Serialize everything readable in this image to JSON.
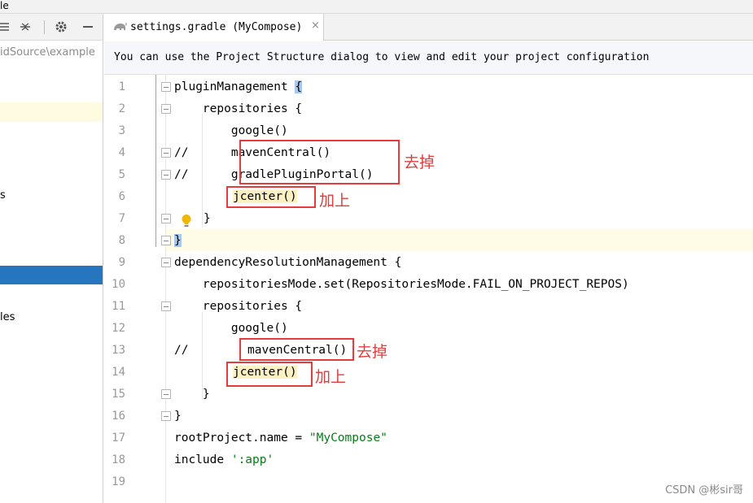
{
  "window": {
    "menu_fragment": "le"
  },
  "project_panel": {
    "toolbar": {
      "collapse_icon": "collapse-all-icon",
      "expand_icon": "expand-all-icon",
      "settings_icon": "gear-icon",
      "hide_icon": "minimize-icon"
    },
    "path_fragment": "idSource\\example",
    "items": [
      {
        "label": "s"
      },
      {
        "label": "les"
      }
    ]
  },
  "editor": {
    "tab": {
      "label": "settings.gradle (MyCompose)",
      "close": "×"
    },
    "banner": "You can use the Project Structure dialog to view and edit your project configuration",
    "line_numbers": [
      "1",
      "2",
      "3",
      "4",
      "5",
      "6",
      "7",
      "8",
      "9",
      "10",
      "11",
      "12",
      "13",
      "14",
      "15",
      "16",
      "17",
      "18",
      "19"
    ],
    "lines": [
      {
        "prefix": "",
        "text": "pluginManagement "
      },
      {
        "prefix": "",
        "text": "    repositories {"
      },
      {
        "prefix": "",
        "text": "        google()"
      },
      {
        "prefix": "//",
        "text": "      mavenCentral()"
      },
      {
        "prefix": "//",
        "text": "      gradlePluginPortal()"
      },
      {
        "prefix": "",
        "text": "jcenter()"
      },
      {
        "prefix": "",
        "text": "}"
      },
      {
        "prefix": "",
        "text": "}"
      },
      {
        "prefix": "",
        "text": "dependencyResolutionManagement {"
      },
      {
        "prefix": "",
        "text": "    repositoriesMode.set(RepositoriesMode.FAIL_ON_PROJECT_REPOS)"
      },
      {
        "prefix": "",
        "text": "    repositories {"
      },
      {
        "prefix": "",
        "text": "        google()"
      },
      {
        "prefix": "//",
        "text": "mavenCentral()"
      },
      {
        "prefix": "",
        "text": "jcenter()"
      },
      {
        "prefix": "",
        "text": "    }"
      },
      {
        "prefix": "",
        "text": "}"
      },
      {
        "prefix": "",
        "text": "rootProject.name = "
      },
      {
        "prefix": "",
        "text": "include "
      },
      {
        "prefix": "",
        "text": ""
      }
    ],
    "open_brace": "{",
    "string_mycompose": "\"MyCompose\"",
    "string_app": "':app'"
  },
  "annotations": {
    "remove_label": "去掉",
    "add_label": "加上"
  },
  "watermark": "CSDN @彬sir哥",
  "colors": {
    "annotation_red": "#e23c3c",
    "string_green": "#067d17",
    "comment_gray": "#8c8c8c",
    "selection_blue": "#2675bf",
    "current_line": "#fefce6"
  }
}
